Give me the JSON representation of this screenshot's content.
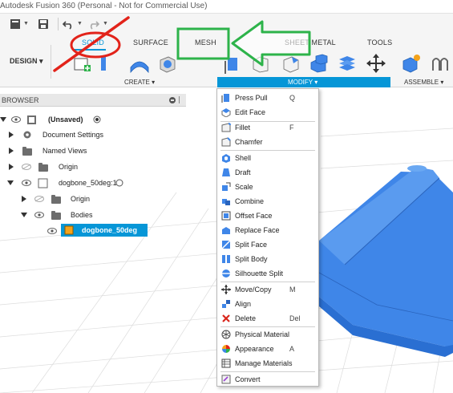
{
  "window": {
    "title": "Autodesk Fusion 360 (Personal - Not for Commercial Use)"
  },
  "workspace": {
    "label": "DESIGN ▾"
  },
  "tabs": [
    {
      "label": "SOLID",
      "active": true
    },
    {
      "label": "SURFACE",
      "active": false
    },
    {
      "label": "MESH",
      "active": false
    },
    {
      "label": "SHEET METAL",
      "active": false
    },
    {
      "label": "TOOLS",
      "active": false
    }
  ],
  "ribbon_groups": {
    "create": "CREATE ▾",
    "modify": "MODIFY ▾",
    "assemble": "ASSEMBLE ▾"
  },
  "browser": {
    "title": "BROWSER",
    "root": "(Unsaved)",
    "items": [
      {
        "label": "Document Settings"
      },
      {
        "label": "Named Views"
      },
      {
        "label": "Origin"
      },
      {
        "label": "dogbone_50deg:1"
      },
      {
        "label": "Origin"
      },
      {
        "label": "Bodies"
      },
      {
        "label": "dogbone_50deg"
      }
    ]
  },
  "modify_menu": {
    "items": [
      {
        "label": "Press Pull",
        "shortcut": "Q",
        "icon": "press-pull-icon"
      },
      {
        "label": "Edit Face",
        "shortcut": "",
        "icon": "edit-face-icon"
      },
      {
        "label": "Fillet",
        "shortcut": "F",
        "icon": "fillet-icon"
      },
      {
        "label": "Chamfer",
        "shortcut": "",
        "icon": "chamfer-icon"
      },
      {
        "label": "Shell",
        "shortcut": "",
        "icon": "shell-icon"
      },
      {
        "label": "Draft",
        "shortcut": "",
        "icon": "draft-icon"
      },
      {
        "label": "Scale",
        "shortcut": "",
        "icon": "scale-icon"
      },
      {
        "label": "Combine",
        "shortcut": "",
        "icon": "combine-icon"
      },
      {
        "label": "Offset Face",
        "shortcut": "",
        "icon": "offset-face-icon"
      },
      {
        "label": "Replace Face",
        "shortcut": "",
        "icon": "replace-face-icon"
      },
      {
        "label": "Split Face",
        "shortcut": "",
        "icon": "split-face-icon"
      },
      {
        "label": "Split Body",
        "shortcut": "",
        "icon": "split-body-icon"
      },
      {
        "label": "Silhouette Split",
        "shortcut": "",
        "icon": "silhouette-split-icon"
      },
      {
        "label": "Move/Copy",
        "shortcut": "M",
        "icon": "move-copy-icon"
      },
      {
        "label": "Align",
        "shortcut": "",
        "icon": "align-icon"
      },
      {
        "label": "Delete",
        "shortcut": "Del",
        "icon": "delete-icon"
      },
      {
        "label": "Physical Material",
        "shortcut": "",
        "icon": "physical-material-icon"
      },
      {
        "label": "Appearance",
        "shortcut": "A",
        "icon": "appearance-icon"
      },
      {
        "label": "Manage Materials",
        "shortcut": "",
        "icon": "manage-materials-icon"
      },
      {
        "label": "Convert",
        "shortcut": "",
        "icon": "convert-icon"
      }
    ]
  },
  "colors": {
    "accent": "#0696d7",
    "model": "#3f86e8",
    "annotation_red": "#e2231a",
    "annotation_green": "#2db34a"
  }
}
